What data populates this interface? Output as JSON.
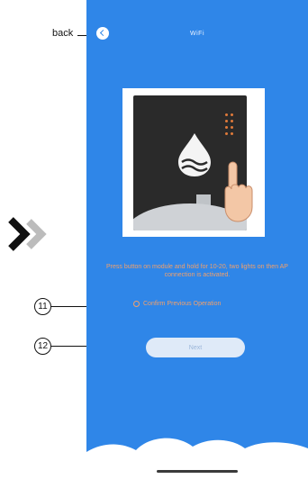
{
  "annotations": {
    "back_label": "back",
    "callout_11": "11",
    "callout_12": "12"
  },
  "screen": {
    "title": "WiFi",
    "instruction": "Press button on module and hold for 10-20, two lights on then AP connection is activated.",
    "confirm_label": "Confirm Previous Operation",
    "next_label": "Next"
  },
  "colors": {
    "background": "#2f86e8",
    "accent_text": "#f2a06a",
    "button_fill": "#dfeaf8",
    "chevron_dark": "#111111",
    "chevron_light": "#bcbcbc"
  },
  "icons": [
    "back-icon",
    "water-drop-icon",
    "hand-pointer-icon",
    "chevrons-right-icon",
    "checkbox-icon"
  ]
}
